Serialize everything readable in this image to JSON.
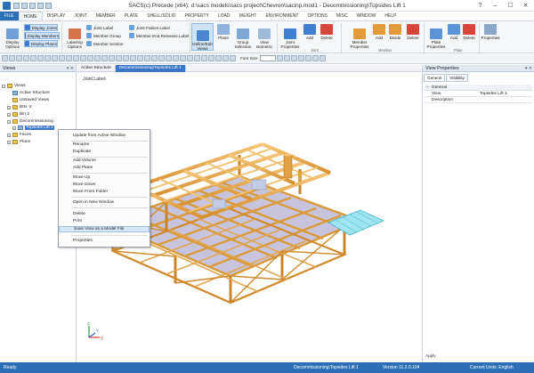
{
  "app": {
    "title": "SACS(c) Precede (x64):  d:\\sacs models\\sacs project\\Chevron\\sacinp.mod1 - Decommissioning\\Topsides Lift 1"
  },
  "window_controls": [
    "?",
    "–",
    "☐",
    "✕"
  ],
  "ribbon_tabs": [
    "FILE",
    "HOME",
    "DISPLAY",
    "JOINT",
    "MEMBER",
    "PLATE",
    "SHELL/SOLID",
    "PROPERTY",
    "LOAD",
    "WEIGHT",
    "ENVIRONMENT",
    "OPTIONS",
    "MISC",
    "WINDOW",
    "HELP"
  ],
  "ribbon": {
    "display_options": "Display\nOptions",
    "display_joints": "Display Joints",
    "display_members": "Display Members",
    "display_plates": "Display Plates",
    "labeling_options": "Labeling\nOptions",
    "joint_label": "Joint Label",
    "member_group": "Member Group",
    "member_section": "Member Section",
    "joint_fixities_label": "Joint Fixities Label",
    "member_end_releases_label": "Member End Releases Label",
    "define_edit_views": "Define/Edit\nViews",
    "plane": "Plane",
    "group_selection": "Group\nSelection",
    "view_isometric": "View\nIsometric",
    "joint_properties": "Joint\nProperties",
    "add": "Add",
    "delete": "Delete",
    "member_properties": "Member\nProperties",
    "divide": "Divide",
    "plate_properties": "Plate\nProperties",
    "properties": "Properties",
    "groups": {
      "joint": "Joint",
      "member": "Member",
      "plate": "Plate"
    }
  },
  "toolbar": {
    "font_size_label": "Font Size"
  },
  "views_panel": {
    "title": "Views",
    "root": "Views",
    "items": [
      {
        "label": "Active Structure"
      },
      {
        "label": "Unsaved Views"
      },
      {
        "label": "BIN -3"
      },
      {
        "label": "Bin 2"
      },
      {
        "label": "Decommissioning"
      },
      {
        "label": "Topsides Lift 1"
      },
      {
        "label": "Faces"
      },
      {
        "label": "Plans"
      }
    ]
  },
  "doc_tabs": [
    "Active Structure",
    "Decommissioning\\Topsides Lift 1"
  ],
  "canvas": {
    "joint_label": "Joint Label:"
  },
  "context_menu": [
    {
      "label": "Update from Active Window"
    },
    {
      "label": "Rename"
    },
    {
      "label": "Duplicate"
    },
    {
      "label": "Add Volume"
    },
    {
      "label": "Add Plane"
    },
    {
      "label": "Move Up"
    },
    {
      "label": "Move Down"
    },
    {
      "label": "Move From Folder"
    },
    {
      "label": "Open in New Window"
    },
    {
      "label": "Delete"
    },
    {
      "label": "Print"
    },
    {
      "label": "Save View as a Model File"
    },
    {
      "label": "Properties"
    }
  ],
  "properties_panel": {
    "title": "View Properties",
    "tabs": [
      "General",
      "Visibility"
    ],
    "section": "General",
    "rows": [
      {
        "key": "View",
        "value": "Topsides Lift 1"
      },
      {
        "key": "Description",
        "value": ""
      }
    ],
    "apply": "Apply"
  },
  "status": {
    "left": "Ready",
    "center": "Decommissioning\\Topsides Lift 1",
    "version": "Version 11.2.0.104",
    "units": "Current Units: English"
  },
  "colors": {
    "accent": "#2b6fb6",
    "structure": "#e8a640",
    "highlight": "#3a77c9"
  }
}
